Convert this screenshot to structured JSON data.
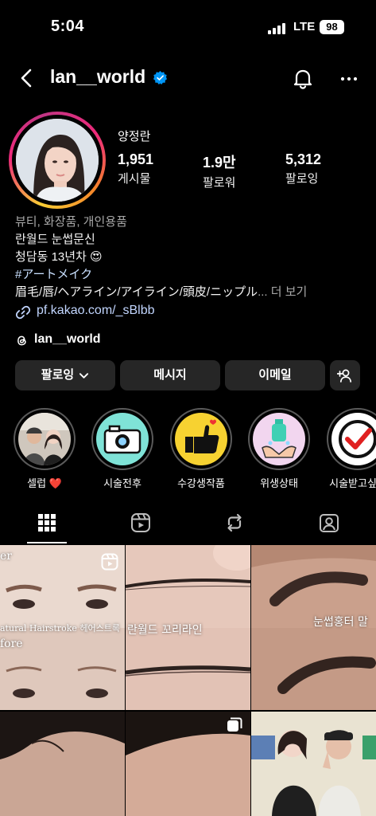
{
  "status_bar": {
    "time": "5:04",
    "network": "LTE",
    "battery": "98"
  },
  "header": {
    "username": "lan__world"
  },
  "profile": {
    "display_name": "양정란",
    "stats": [
      {
        "value": "1,951",
        "label": "게시물"
      },
      {
        "value": "1.9만",
        "label": "팔로워"
      },
      {
        "value": "5,312",
        "label": "팔로잉"
      }
    ],
    "category": "뷰티, 화장품, 개인용품",
    "bio_line1": "란월드 눈썹문신",
    "bio_line2": "청담동 13년차 😍",
    "hashtag": "#アートメイク",
    "bio_line4": "眉毛/唇/ヘアライン/アイライン/頭皮/ニップル",
    "ellipsis": "...",
    "more": "더 보기",
    "link": "pf.kakao.com/_sBlbb",
    "threads": "lan__world"
  },
  "buttons": {
    "following": "팔로잉",
    "message": "메시지",
    "email": "이메일"
  },
  "highlights": [
    {
      "label": "셀럽 ❤️"
    },
    {
      "label": "시술전후"
    },
    {
      "label": "수강생작품"
    },
    {
      "label": "위생상태"
    },
    {
      "label": "시술받고싶어"
    }
  ],
  "grid_text": {
    "post1_top": "er",
    "post1_mid": "atural Hairstroke 헤어스트록",
    "post1_bottom": "fore",
    "post2_caption": "란월드 꼬리라인",
    "post3_caption": "눈썹홍터 말"
  },
  "colors": {
    "background": "#000000",
    "button": "#262626",
    "verified": "#0095f6",
    "link": "#c2d6ff"
  }
}
